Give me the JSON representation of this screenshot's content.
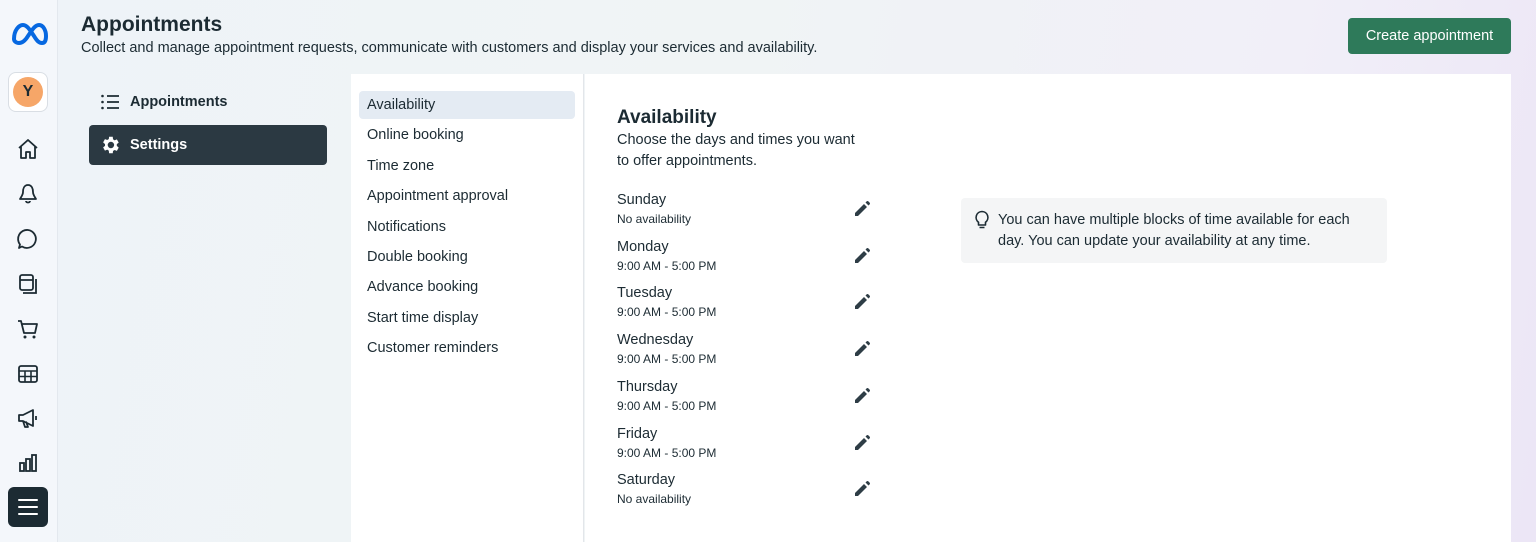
{
  "header": {
    "title": "Appointments",
    "subtitle": "Collect and manage appointment requests, communicate with customers and display your services and availability.",
    "create_button": "Create appointment"
  },
  "rail": {
    "avatar_initial": "Y",
    "icons": [
      "meta-logo-icon",
      "home-icon",
      "bell-icon",
      "chat-icon",
      "posts-icon",
      "cart-icon",
      "table-icon",
      "megaphone-icon",
      "bar-chart-icon",
      "menu-icon"
    ]
  },
  "section_nav": [
    {
      "label": "Appointments",
      "icon": "list-icon",
      "active": false
    },
    {
      "label": "Settings",
      "icon": "gear-icon",
      "active": true
    }
  ],
  "settings_menu": [
    {
      "label": "Availability",
      "active": true
    },
    {
      "label": "Online booking"
    },
    {
      "label": "Time zone"
    },
    {
      "label": "Appointment approval"
    },
    {
      "label": "Notifications"
    },
    {
      "label": "Double booking"
    },
    {
      "label": "Advance booking"
    },
    {
      "label": "Start time display"
    },
    {
      "label": "Customer reminders"
    }
  ],
  "availability": {
    "title": "Availability",
    "description": "Choose the days and times you want to offer appointments.",
    "days": [
      {
        "day": "Sunday",
        "hours": "No availability"
      },
      {
        "day": "Monday",
        "hours": "9:00 AM - 5:00 PM"
      },
      {
        "day": "Tuesday",
        "hours": "9:00 AM - 5:00 PM"
      },
      {
        "day": "Wednesday",
        "hours": "9:00 AM - 5:00 PM"
      },
      {
        "day": "Thursday",
        "hours": "9:00 AM - 5:00 PM"
      },
      {
        "day": "Friday",
        "hours": "9:00 AM - 5:00 PM"
      },
      {
        "day": "Saturday",
        "hours": "No availability"
      }
    ],
    "tip": "You can have multiple blocks of time available for each day. You can update your availability at any time."
  },
  "colors": {
    "primary_button": "#2e7a5a",
    "active_nav": "#2b3942",
    "active_option": "#e4ebf3",
    "avatar": "#f6a668",
    "meta_blue": "#0668e1"
  }
}
